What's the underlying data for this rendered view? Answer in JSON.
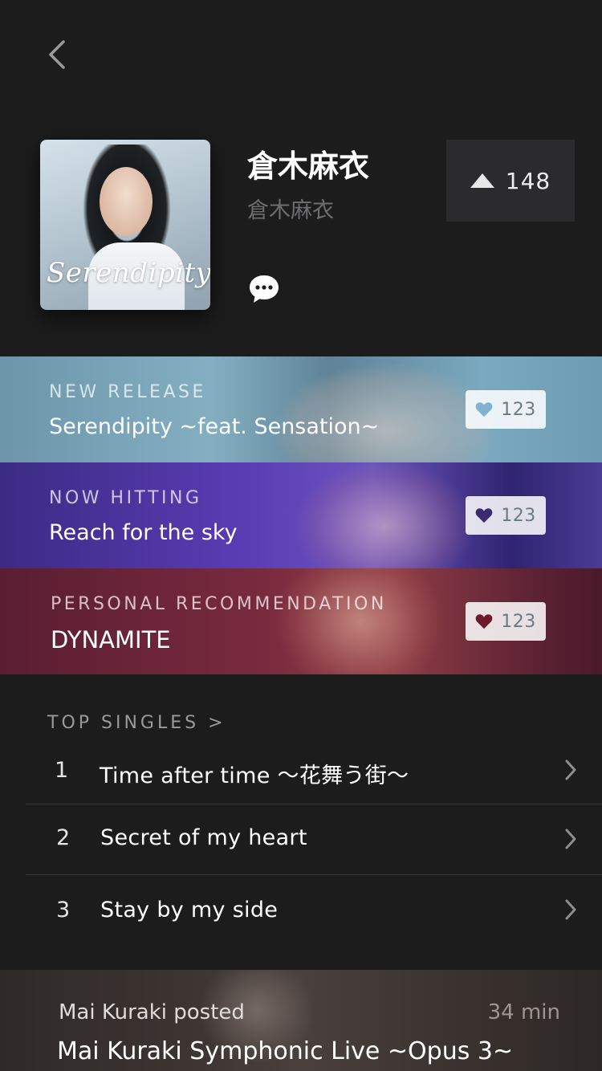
{
  "header": {
    "back_icon": "chevron-left-icon"
  },
  "artist": {
    "name": "倉木麻衣",
    "name_sub": "倉木麻衣",
    "album_cover_text": "Serendipity",
    "upvote_count": "148",
    "comment_icon": "speech-bubble-icon"
  },
  "banners": [
    {
      "tag": "NEW RELEASE",
      "title": "Serendipity ~feat. Sensation~",
      "likes": "123",
      "heart_color": "#7fb3d0",
      "accent": "#6c95a9"
    },
    {
      "tag": "NOW HITTING",
      "title": "Reach for the sky",
      "likes": "123",
      "heart_color": "#3b2b6e",
      "accent": "#5a3cb3"
    },
    {
      "tag": "PERSONAL RECOMMENDATION",
      "title": "DYNAMITE",
      "likes": "123",
      "heart_color": "#6a1a2c",
      "accent": "#7a2b3e"
    }
  ],
  "top_singles": {
    "heading": "TOP SINGLES >",
    "items": [
      {
        "rank": "1",
        "title": "Time after time ～花舞う街～"
      },
      {
        "rank": "2",
        "title": "Secret of my heart"
      },
      {
        "rank": "3",
        "title": "Stay by my side"
      }
    ]
  },
  "post": {
    "author": "Mai Kuraki posted",
    "time": "34 min",
    "title": "Mai Kuraki Symphonic Live ~Opus 3~"
  }
}
